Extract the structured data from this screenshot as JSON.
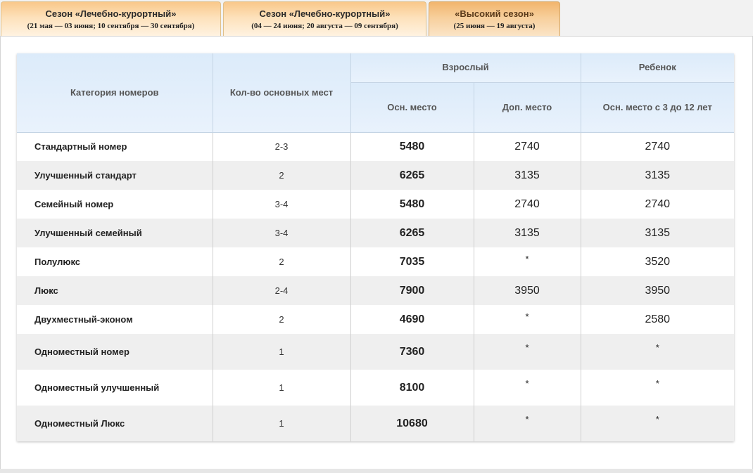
{
  "tabs": [
    {
      "title": "Сезон «Лечебно-курортный»",
      "dates": "(21 мая — 03 июня; 10 сентября — 30 сентября)"
    },
    {
      "title": "Сезон «Лечебно-курортный»",
      "dates": "(04 — 24 июня; 20 августа — 09 сентября)"
    },
    {
      "title": "«Высокий сезон»",
      "dates": "(25 июня — 19 августа)"
    }
  ],
  "table": {
    "headers": {
      "category": "Категория номеров",
      "places": "Кол-во основных мест",
      "adult": "Взрослый",
      "child": "Ребенок",
      "adult_main": "Осн. место",
      "adult_extra": "Доп. место",
      "child_main": "Осн. место с 3 до 12 лет"
    },
    "rows": [
      {
        "category": "Стандартный номер",
        "places": "2-3",
        "adult_main": "5480",
        "adult_extra": "2740",
        "child_main": "2740"
      },
      {
        "category": "Улучшенный стандарт",
        "places": "2",
        "adult_main": "6265",
        "adult_extra": "3135",
        "child_main": "3135"
      },
      {
        "category": "Семейный номер",
        "places": "3-4",
        "adult_main": "5480",
        "adult_extra": "2740",
        "child_main": "2740"
      },
      {
        "category": "Улучшенный семейный",
        "places": "3-4",
        "adult_main": "6265",
        "adult_extra": "3135",
        "child_main": "3135"
      },
      {
        "category": "Полулюкс",
        "places": "2",
        "adult_main": "7035",
        "adult_extra": "*",
        "child_main": "3520"
      },
      {
        "category": "Люкс",
        "places": "2-4",
        "adult_main": "7900",
        "adult_extra": "3950",
        "child_main": "3950"
      },
      {
        "category": "Двухместный-эконом",
        "places": "2",
        "adult_main": "4690",
        "adult_extra": "*",
        "child_main": "2580"
      },
      {
        "category": "Одноместный номер",
        "places": "1",
        "adult_main": "7360",
        "adult_extra": "*",
        "child_main": "*"
      },
      {
        "category": "Одноместный улучшенный",
        "places": "1",
        "adult_main": "8100",
        "adult_extra": "*",
        "child_main": "*"
      },
      {
        "category": "Одноместный Люкс",
        "places": "1",
        "adult_main": "10680",
        "adult_extra": "*",
        "child_main": "*"
      }
    ]
  }
}
